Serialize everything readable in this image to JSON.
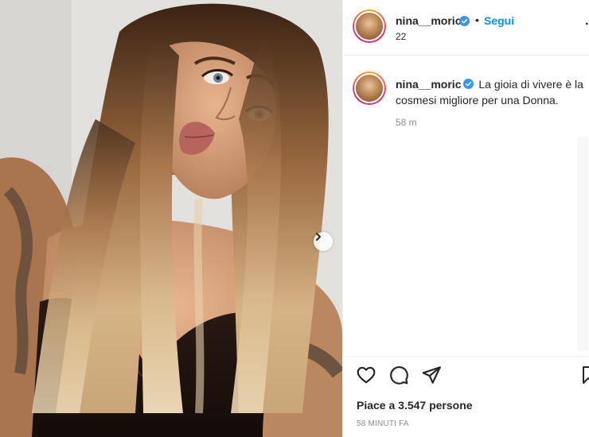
{
  "post": {
    "username": "nina__moric",
    "follow_label": "Segui",
    "separator": "•",
    "sub_count": "22",
    "more_icon": "more-options-icon",
    "verified_color": "#3897f0",
    "accent_color": "#0095f6"
  },
  "caption": {
    "username": "nina__moric",
    "text": "La gioia di vivere è la cosmesi migliore per una Donna.",
    "time": "58 m"
  },
  "actions": {
    "likes": "Piace a 3.547 persone",
    "time_ago": "58 MINUTI FA",
    "icons": [
      "heart-icon",
      "comment-icon",
      "share-icon",
      "bookmark-icon"
    ]
  },
  "carousel": {
    "next_icon": "chevron-right-icon"
  }
}
